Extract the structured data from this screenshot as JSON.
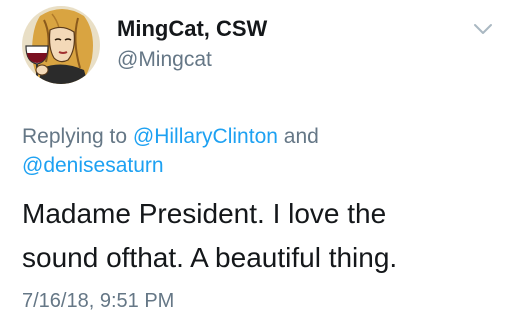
{
  "user": {
    "display_name": "MingCat, CSW",
    "handle": "@Mingcat"
  },
  "reply": {
    "prefix": "Replying to",
    "mention_1": "@HillaryClinton",
    "joiner": "and",
    "mention_2": "@denisesaturn"
  },
  "tweet": {
    "line_1": "Madame President. I love the",
    "line_2": "sound ofthat. A beautiful thing.",
    "timestamp": "7/16/18, 9:51 PM"
  },
  "icons": {
    "menu": "chevron-down-icon",
    "avatar": "avatar-illustration"
  },
  "colors": {
    "text": "#14171a",
    "secondary": "#657786",
    "link": "#1da1f2"
  }
}
